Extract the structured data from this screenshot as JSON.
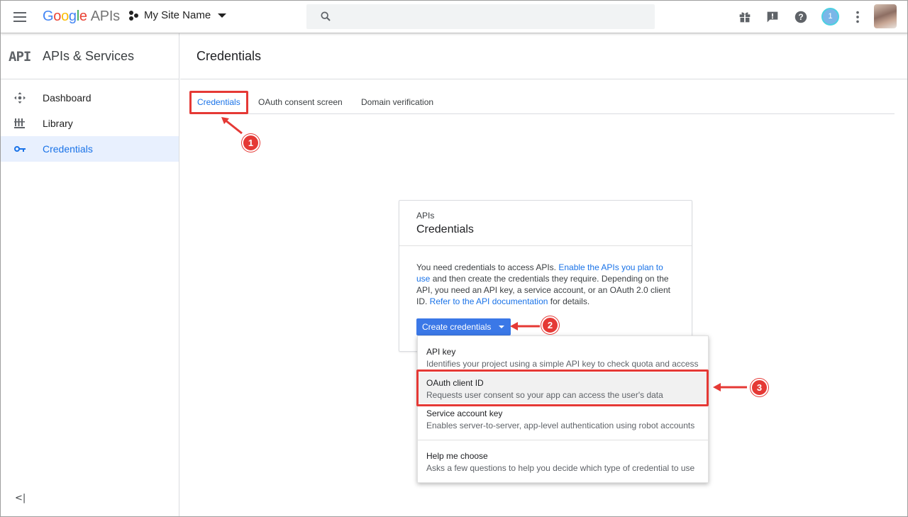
{
  "topbar": {
    "logo_google": [
      "G",
      "o",
      "o",
      "g",
      "l",
      "e"
    ],
    "logo_apis": "APIs",
    "project_name": "My Site Name",
    "notification_count": "1",
    "icons": [
      "menu-icon",
      "search-icon",
      "gift-icon",
      "feedback-icon",
      "help-icon",
      "notifications-icon",
      "more-vert-icon",
      "avatar"
    ]
  },
  "sidebar": {
    "logo_text": "API",
    "title": "APIs & Services",
    "items": [
      {
        "label": "Dashboard",
        "icon": "dashboard-icon"
      },
      {
        "label": "Library",
        "icon": "library-icon"
      },
      {
        "label": "Credentials",
        "icon": "key-icon",
        "active": true
      }
    ],
    "collapse_label": "<|"
  },
  "main": {
    "page_title": "Credentials",
    "tabs": [
      {
        "label": "Credentials",
        "active": true
      },
      {
        "label": "OAuth consent screen"
      },
      {
        "label": "Domain verification"
      }
    ]
  },
  "card": {
    "overline": "APIs",
    "title": "Credentials",
    "body_1": "You need credentials to access APIs. ",
    "link_1": "Enable the APIs you plan to use",
    "body_2": " and then create the credentials they require. Depending on the API, you need an API key, a service account, or an OAuth 2.0 client ID. ",
    "link_2": "Refer to the API documentation",
    "body_3": " for details.",
    "button_label": "Create credentials"
  },
  "menu": {
    "items": [
      {
        "title": "API key",
        "description": "Identifies your project using a simple API key to check quota and access"
      },
      {
        "title": "OAuth client ID",
        "description": "Requests user consent so your app can access the user's data",
        "highlighted": true
      },
      {
        "title": "Service account key",
        "description": "Enables server-to-server, app-level authentication using robot accounts"
      },
      {
        "title": "Help me choose",
        "description": "Asks a few questions to help you decide which type of credential to use"
      }
    ]
  },
  "annotations": {
    "step_1": "1",
    "step_2": "2",
    "step_3": "3",
    "color": "#e53935"
  },
  "colors": {
    "accent": "#1a73e8",
    "button": "#3b78e7",
    "active_bg": "#e8f0fe"
  }
}
